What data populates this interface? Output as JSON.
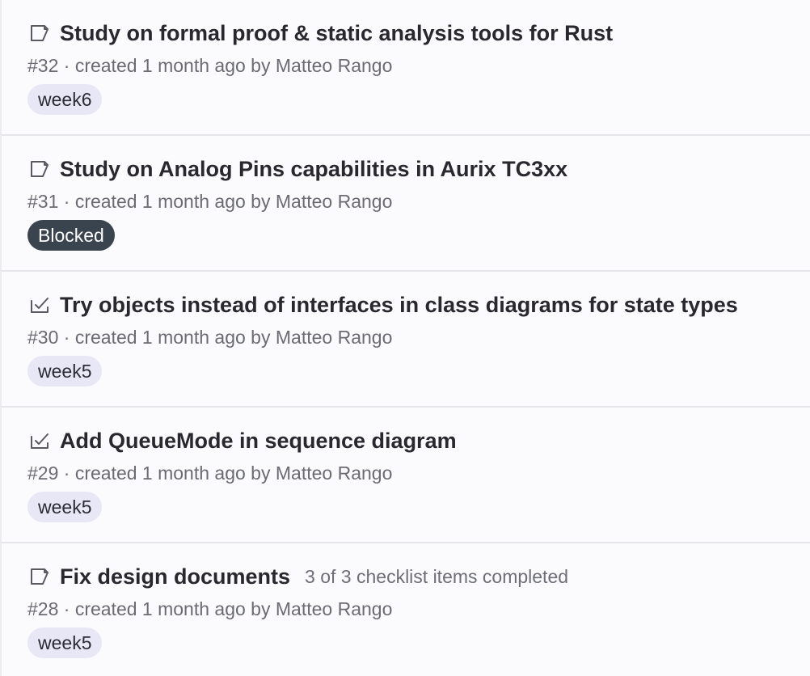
{
  "issues": [
    {
      "icon": "issue-open-icon",
      "title": "Study on formal proof & static analysis tools for Rust",
      "checklist": "",
      "number": "#32",
      "created": "· created 1 month ago by",
      "author": "Matteo Rango",
      "label": "week6",
      "label_style": "light",
      "label_color": "#e8e7f6"
    },
    {
      "icon": "issue-open-icon",
      "title": "Study on Analog Pins capabilities in Aurix TC3xx",
      "checklist": "",
      "number": "#31",
      "created": "· created 1 month ago by",
      "author": "Matteo Rango",
      "label": "Blocked",
      "label_style": "dark",
      "label_color": "#3a444e"
    },
    {
      "icon": "task-done-icon",
      "title": "Try objects instead of interfaces in class diagrams for state types",
      "checklist": "",
      "number": "#30",
      "created": "· created 1 month ago by",
      "author": "Matteo Rango",
      "label": "week5",
      "label_style": "light",
      "label_color": "#e8e7f6"
    },
    {
      "icon": "task-done-icon",
      "title": "Add QueueMode in sequence diagram",
      "checklist": "",
      "number": "#29",
      "created": "· created 1 month ago by",
      "author": "Matteo Rango",
      "label": "week5",
      "label_style": "light",
      "label_color": "#e8e7f6"
    },
    {
      "icon": "issue-open-icon",
      "title": "Fix design documents",
      "checklist": "3 of 3 checklist items completed",
      "number": "#28",
      "created": "· created 1 month ago by",
      "author": "Matteo Rango",
      "label": "week5",
      "label_style": "light",
      "label_color": "#e8e7f6"
    }
  ]
}
